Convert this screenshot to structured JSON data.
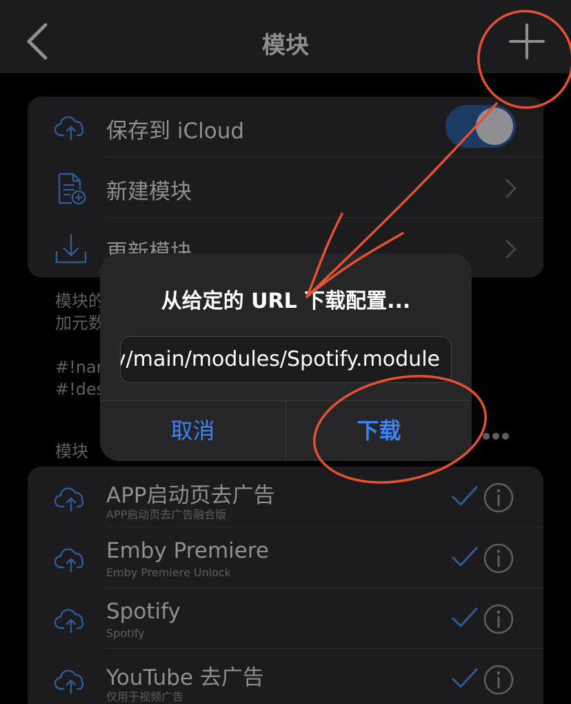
{
  "nav": {
    "title": "模块",
    "back_icon": "chevron-left-icon",
    "add_icon": "plus-icon"
  },
  "settings": {
    "icloud_label": "保存到 iCloud",
    "icloud_enabled": true,
    "new_module_label": "新建模块",
    "update_module_label": "更新模块"
  },
  "footer": {
    "line1": "模块的",
    "line2": "加元数",
    "line3": "#!nam",
    "line4": "#!des"
  },
  "modules_section": {
    "header": "模块",
    "items": [
      {
        "title": "APP启动页去广告",
        "subtitle": "APP启动页去广告融合版",
        "enabled": true
      },
      {
        "title": "Emby Premiere",
        "subtitle": "Emby Premiere Unlock",
        "enabled": true
      },
      {
        "title": "Spotify",
        "subtitle": "Spotify",
        "enabled": true
      },
      {
        "title": "YouTube 去广告",
        "subtitle": "仅用于视频广告",
        "enabled": true
      }
    ]
  },
  "alert": {
    "title": "从给定的 URL 下载配置...",
    "input_value": "v/main/modules/Spotify.module",
    "cancel_label": "取消",
    "download_label": "下载"
  },
  "colors": {
    "accent": "#3a82f7",
    "annotation": "#e8512f",
    "toggle_on": "#1d3a63"
  }
}
